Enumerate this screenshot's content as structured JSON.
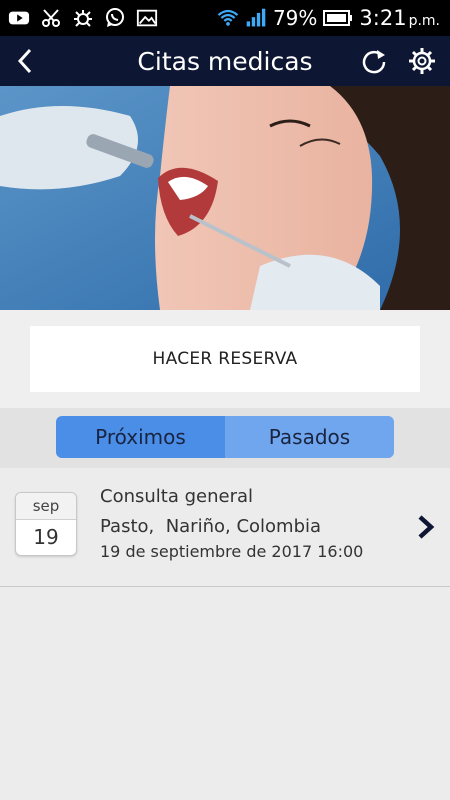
{
  "status_bar": {
    "icons": [
      "youtube-icon",
      "scissors-icon",
      "bug-icon",
      "whatsapp-icon",
      "image-icon",
      "wifi-icon",
      "signal-icon"
    ],
    "battery_percent": "79%",
    "time": "3:21",
    "ampm": "p.m."
  },
  "header": {
    "title": "Citas medicas",
    "back_icon": "back-arrow-icon",
    "refresh_icon": "refresh-icon",
    "settings_icon": "gear-icon",
    "background": "#0d1632"
  },
  "hero": {
    "icon": "dentist-photo"
  },
  "reserve": {
    "label": "HACER RESERVA"
  },
  "tabs": [
    {
      "label": "Próximos",
      "active": true
    },
    {
      "label": "Pasados",
      "active": false
    }
  ],
  "colors": {
    "tab_active": "#4a8ee8",
    "tab_inactive": "#6fa6ee"
  },
  "appointments": [
    {
      "month": "sep",
      "day": "19",
      "title": "Consulta general",
      "location": "Pasto,  Nariño, Colombia",
      "datetime": "19 de septiembre de 2017 16:00"
    }
  ]
}
